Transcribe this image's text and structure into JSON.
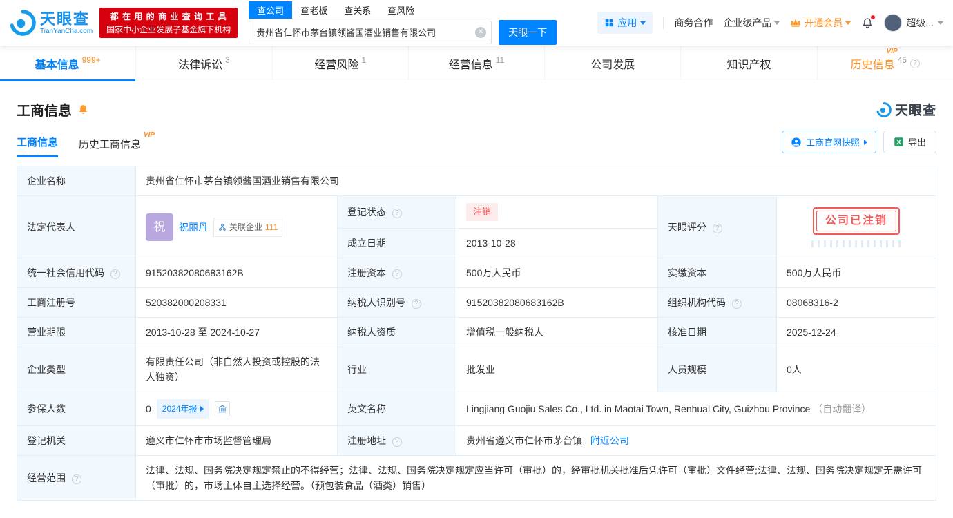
{
  "colors": {
    "accent_blue": "#0084ff",
    "vip_orange": "#ff8f1f",
    "danger_red": "#f25555",
    "promo_red": "#d6000f"
  },
  "header": {
    "logo_cn": "天眼查",
    "logo_en": "TianYanCha.com",
    "promo_line1": "都 在 用 的 商 业 查 询 工 具",
    "promo_line2": "国家中小企业发展子基金旗下机构",
    "search_tabs": [
      {
        "label": "查公司"
      },
      {
        "label": "查老板"
      },
      {
        "label": "查关系"
      },
      {
        "label": "查风险"
      }
    ],
    "search_value": "贵州省仁怀市茅台镇领酱国酒业销售有限公司",
    "search_button": "天眼一下",
    "nav_app": "应用",
    "nav_cooperation": "商务合作",
    "nav_enterprise": "企业级产品",
    "nav_vip": "开通会员",
    "nav_user": "超级..."
  },
  "tabs": [
    {
      "label": "基本信息",
      "count": "999+"
    },
    {
      "label": "法律诉讼",
      "count": "3"
    },
    {
      "label": "经营风险",
      "count": "1"
    },
    {
      "label": "经营信息",
      "count": "11"
    },
    {
      "label": "公司发展",
      "count": ""
    },
    {
      "label": "知识产权",
      "count": ""
    },
    {
      "label": "历史信息",
      "count": "45",
      "vip": "VIP"
    }
  ],
  "section": {
    "title": "工商信息",
    "logo_text": "天眼查",
    "subtab_current": "工商信息",
    "subtab_history": "历史工商信息",
    "vip_tag": "VIP",
    "snapshot_button": "工商官网快照",
    "export_button": "导出"
  },
  "info": {
    "company_name": {
      "label": "企业名称",
      "value": "贵州省仁怀市茅台镇领酱国酒业销售有限公司"
    },
    "legal_rep": {
      "label": "法定代表人",
      "avatar": "祝",
      "name": "祝丽丹",
      "related_label": "关联企业",
      "related_count": "111"
    },
    "reg_status": {
      "label": "登记状态",
      "value": "注销"
    },
    "establish_date": {
      "label": "成立日期",
      "value": "2013-10-28"
    },
    "tyc_score": {
      "label": "天眼评分",
      "stamp": "公司已注销"
    },
    "credit_code": {
      "label": "统一社会信用代码",
      "value": "91520382080683162B"
    },
    "reg_capital": {
      "label": "注册资本",
      "value": "500万人民币"
    },
    "paid_capital": {
      "label": "实缴资本",
      "value": "500万人民币"
    },
    "reg_number": {
      "label": "工商注册号",
      "value": "520382000208331"
    },
    "taxpayer_id": {
      "label": "纳税人识别号",
      "value": "91520382080683162B"
    },
    "org_code": {
      "label": "组织机构代码",
      "value": "08068316-2"
    },
    "business_term": {
      "label": "营业期限",
      "value": "2013-10-28 至 2024-10-27"
    },
    "taxpayer_quality": {
      "label": "纳税人资质",
      "value": "增值税一般纳税人"
    },
    "approval_date": {
      "label": "核准日期",
      "value": "2025-12-24"
    },
    "company_type": {
      "label": "企业类型",
      "value": "有限责任公司（非自然人投资或控股的法人独资）"
    },
    "industry": {
      "label": "行业",
      "value": "批发业"
    },
    "staff_size": {
      "label": "人员规模",
      "value": "0人"
    },
    "insured_count": {
      "label": "参保人数",
      "value": "0",
      "report_tag": "2024年报"
    },
    "english_name": {
      "label": "英文名称",
      "value": "Lingjiang Guojiu Sales Co., Ltd. in Maotai Town, Renhuai City, Guizhou Province",
      "suffix": "（自动翻译）"
    },
    "reg_authority": {
      "label": "登记机关",
      "value": "遵义市仁怀市市场监督管理局"
    },
    "reg_address": {
      "label": "注册地址",
      "value": "贵州省遵义市仁怀市茅台镇",
      "nearby_link": "附近公司"
    },
    "business_scope": {
      "label": "经营范围",
      "value": "法律、法规、国务院决定规定禁止的不得经营；法律、法规、国务院决定规定应当许可（审批）的，经审批机关批准后凭许可（审批）文件经营;法律、法规、国务院决定规定无需许可（审批）的，市场主体自主选择经营。（预包装食品（酒类）销售）"
    }
  }
}
